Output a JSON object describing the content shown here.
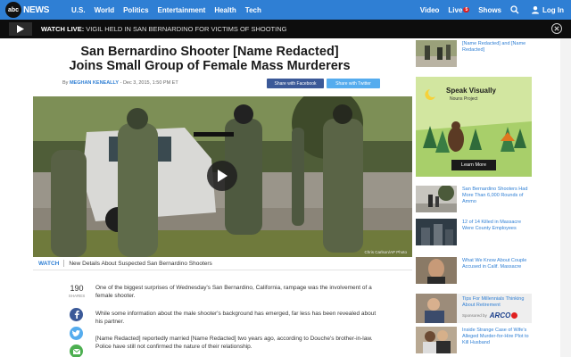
{
  "nav": {
    "logo_text": "abc",
    "logo_news": "NEWS",
    "links": [
      "U.S.",
      "World",
      "Politics",
      "Entertainment",
      "Health",
      "Tech"
    ],
    "video": "Video",
    "live": "Live",
    "live_count": "5",
    "shows": "Shows",
    "login": "Log In"
  },
  "alert": {
    "label": "WATCH LIVE:",
    "text": "VIGIL HELD IN SAN BERNARDINO FOR VICTIMS OF SHOOTING"
  },
  "article": {
    "headline": "San Bernardino Shooter [Name Redacted] Joins Small Group of Female Mass Murderers",
    "by": "By",
    "author": "MEGHAN KENEALLY",
    "date": "- Dec 3, 2015, 1:50 PM ET",
    "share_facebook": "Share with Facebook",
    "share_twitter": "Share with Twitter",
    "photo_credit": "Chris Carlson/AP Photo",
    "watch_label": "WATCH",
    "watch_title": "New Details About Suspected San Bernardino Shooters",
    "share_count": "190",
    "share_label": "SHARES",
    "paragraphs": [
      "One of the biggest surprises of Wednesday's San Bernardino, California, rampage was the involvement of a female shooter.",
      "While some information about the male shooter's background has emerged, far less has been revealed about his partner.",
      "[Name Redacted] reportedly married [Name Redacted] two years ago, according to Douche's brother-in-law. Police have still not confirmed the nature of their relationship."
    ]
  },
  "sidebar": {
    "items": [
      {
        "title": "[Name Redacted] and [Name Redacted]"
      },
      {
        "title": "San Bernardino Shooters Had More Than 6,000 Rounds of Ammo"
      },
      {
        "title": "12 of 14 Killed in Massacre Were County Employees"
      },
      {
        "title": "What We Know About Couple Accused in Calif. Massacre"
      },
      {
        "title": "Inside Strange Case of Wife's Alleged Murder-for-Hire Plot to Kill Husband"
      }
    ],
    "ad": {
      "title": "Speak Visually",
      "sub": "Nouns Project",
      "button": "Learn More"
    },
    "sponsor": {
      "title": "Tips For Millennials Thinking About Retirement",
      "by": "Sponsored by",
      "brand": "ARCO"
    }
  },
  "colors": {
    "nav_blue": "#2f7fd4",
    "alert_bg": "#0d0d0d",
    "facebook": "#3b5998",
    "twitter": "#55acee"
  }
}
